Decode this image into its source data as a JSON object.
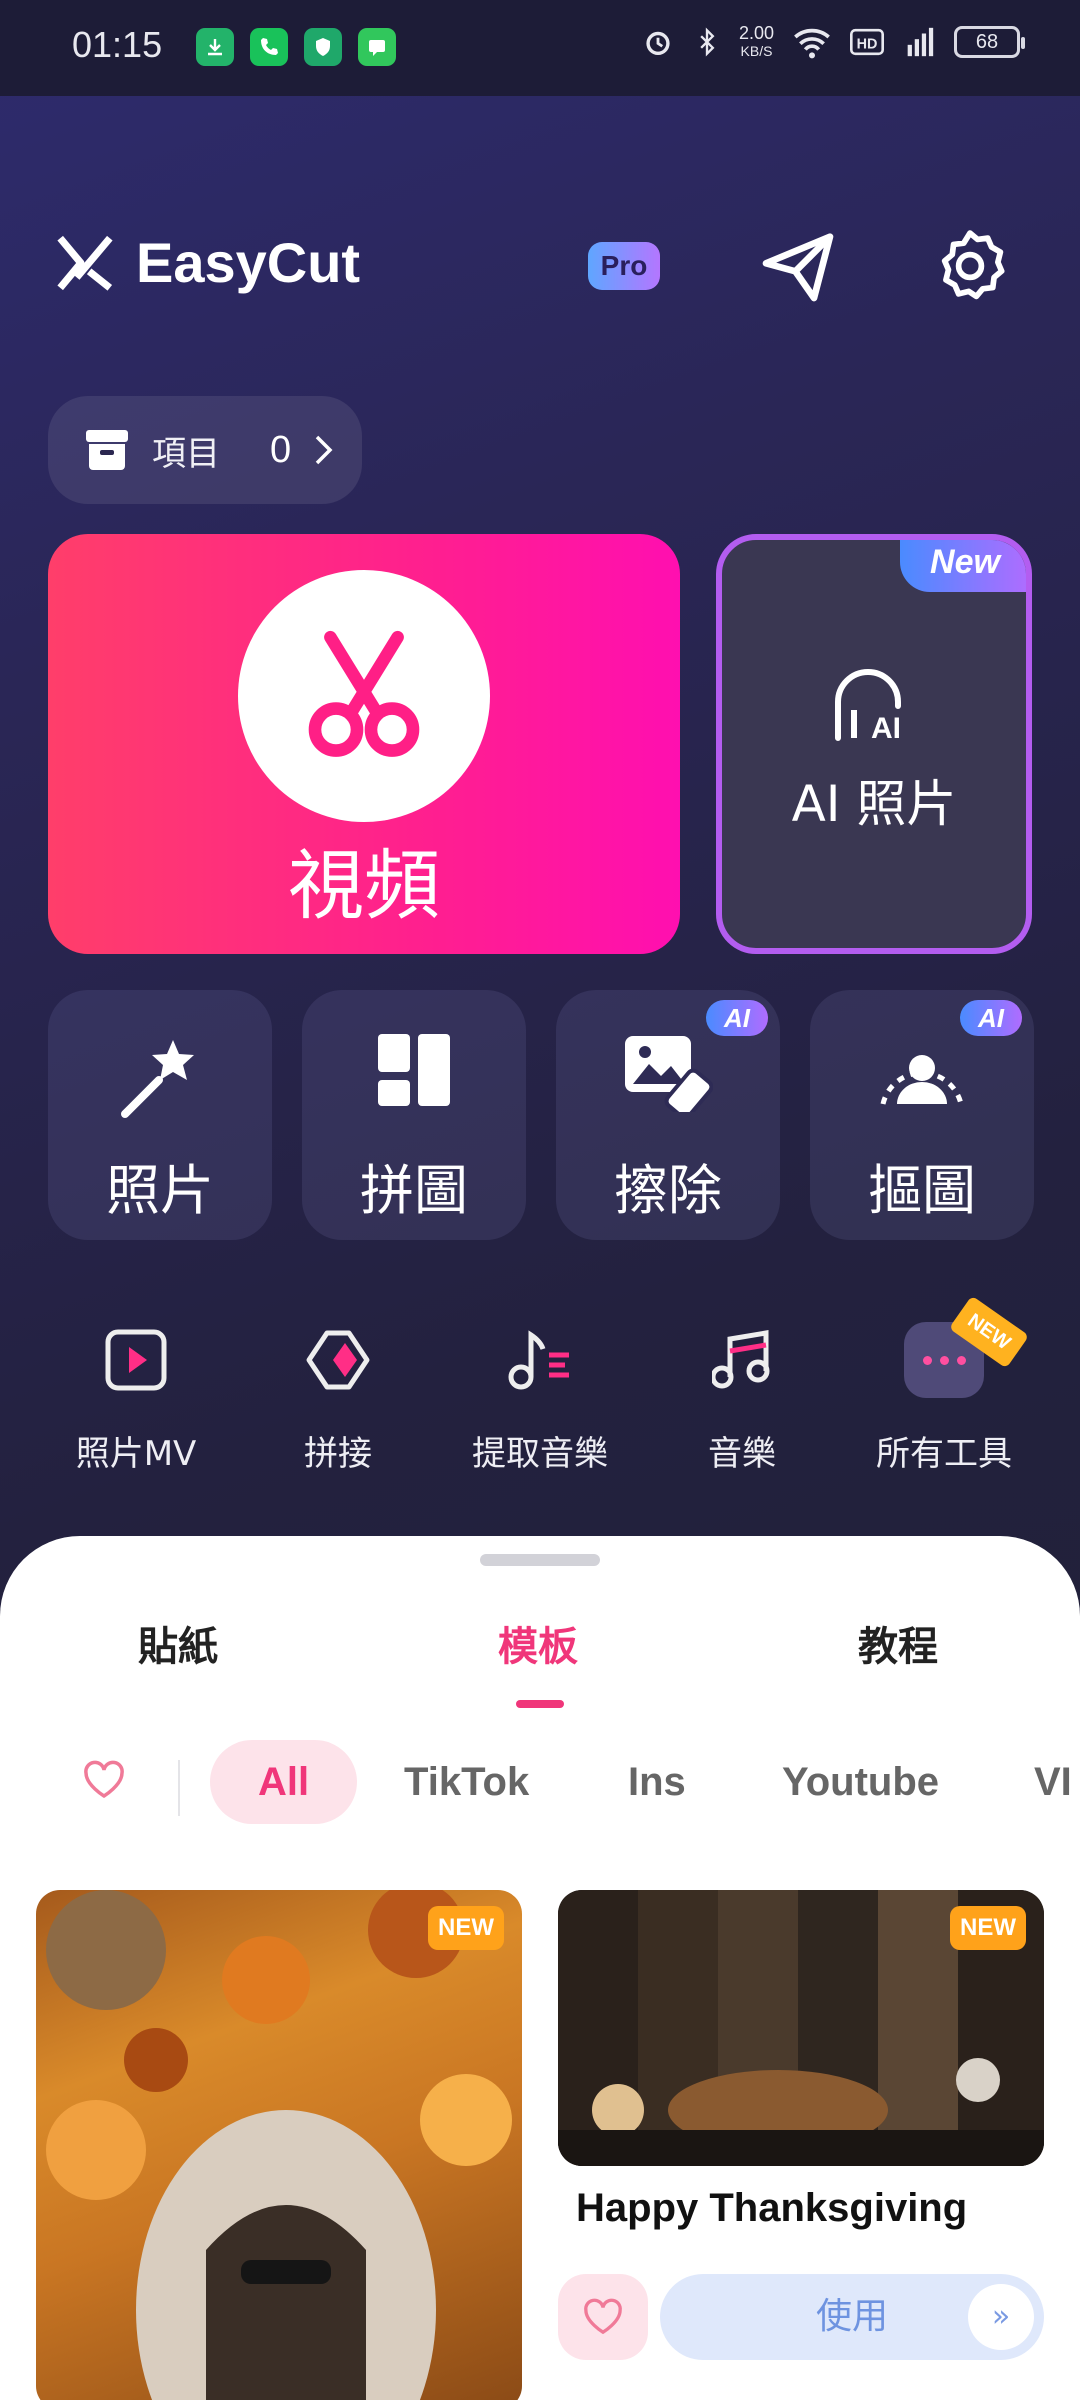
{
  "status": {
    "time": "01:15",
    "speed_value": "2.00",
    "speed_unit": "KB/S",
    "battery": "68"
  },
  "header": {
    "brand": "EasyCut",
    "pro": "Pro"
  },
  "projects": {
    "label": "項目",
    "count": "0"
  },
  "main": {
    "video_label": "視頻",
    "ai_label": "AI 照片",
    "new_tag": "New"
  },
  "tiles": [
    {
      "label": "照片",
      "icon": "magic-wand-icon"
    },
    {
      "label": "拼圖",
      "icon": "collage-icon"
    },
    {
      "label": "擦除",
      "icon": "eraser-icon",
      "badge": "AI"
    },
    {
      "label": "摳圖",
      "icon": "cutout-icon",
      "badge": "AI"
    }
  ],
  "tools": [
    {
      "label": "照片MV",
      "icon": "play-square-icon"
    },
    {
      "label": "拼接",
      "icon": "merge-icon"
    },
    {
      "label": "提取音樂",
      "icon": "extract-music-icon"
    },
    {
      "label": "音樂",
      "icon": "music-note-icon"
    },
    {
      "label": "所有工具",
      "icon": "more-icon",
      "badge": "NEW"
    }
  ],
  "sheet": {
    "tabs": [
      "貼紙",
      "模板",
      "教程"
    ],
    "active_tab": "模板",
    "chips": [
      "All",
      "TikTok",
      "Ins",
      "Youtube",
      "VI"
    ],
    "active_chip": "All",
    "cards": [
      {
        "badge": "NEW"
      },
      {
        "badge": "NEW",
        "title": "Happy Thanksgiving",
        "use_label": "使用",
        "arrow": "»"
      }
    ]
  },
  "colors": {
    "accent": "#f0367a",
    "video_gradient_start": "#ff3e6a",
    "video_gradient_end": "#ff0fb0",
    "ai_border": "#b35df0"
  }
}
